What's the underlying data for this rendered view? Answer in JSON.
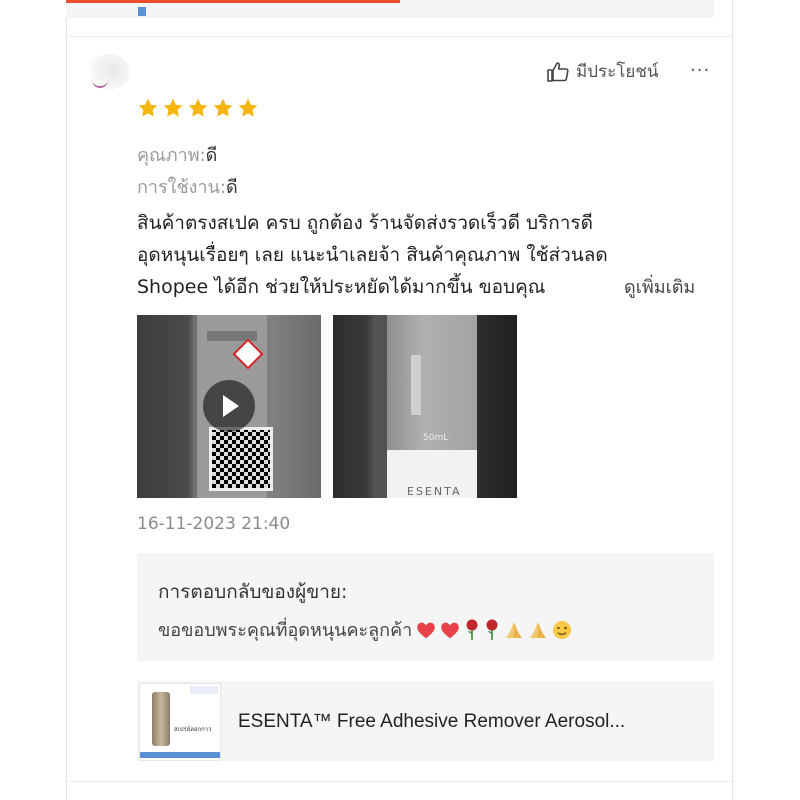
{
  "top_strip": {
    "tag_text": ""
  },
  "review": {
    "helpful_label": "มีประโยชน์",
    "more_label": "···",
    "rating": 5,
    "rating_max": 5,
    "attributes": [
      {
        "key": "คุณภาพ:",
        "value": "ดี"
      },
      {
        "key": "การใช้งาน:",
        "value": "ดี"
      }
    ],
    "text_lines": [
      "สินค้าตรงสเปค ครบ ถูกต้อง ร้านจัดส่งรวดเร็วดี บริการดี",
      "อุดหนุนเรื่อยๆ เลย แนะนำเลยจ้า สินค้าคุณภาพ ใช้ส่วนลด",
      "Shopee ได้อีก ช่วยให้ประหยัดได้มากขึ้น ขอบคุณ"
    ],
    "see_more_label": "ดูเพิ่มเติม",
    "media": [
      {
        "kind": "video"
      },
      {
        "kind": "image",
        "text_ml": "50mL",
        "text_brand": "ESENTA"
      }
    ],
    "date": "16-11-2023 21:40"
  },
  "seller_reply": {
    "title": "การตอบกลับของผู้ขาย:",
    "message": "ขอขอบพระคุณที่อุดหนุนคะลูกค้า",
    "emojis": [
      "heart-icon",
      "heart-icon",
      "rose-icon",
      "rose-icon",
      "pray-icon",
      "pray-icon",
      "wink-icon"
    ]
  },
  "product": {
    "name": "ESENTA™  Free Adhesive Remover Aerosol...",
    "thumb_text": "สเปรย์ลอกกาว"
  },
  "colors": {
    "star": "#f6b60f",
    "accent": "#ee4d2d",
    "heart": "#e8414a",
    "rose": "#c0272d"
  }
}
